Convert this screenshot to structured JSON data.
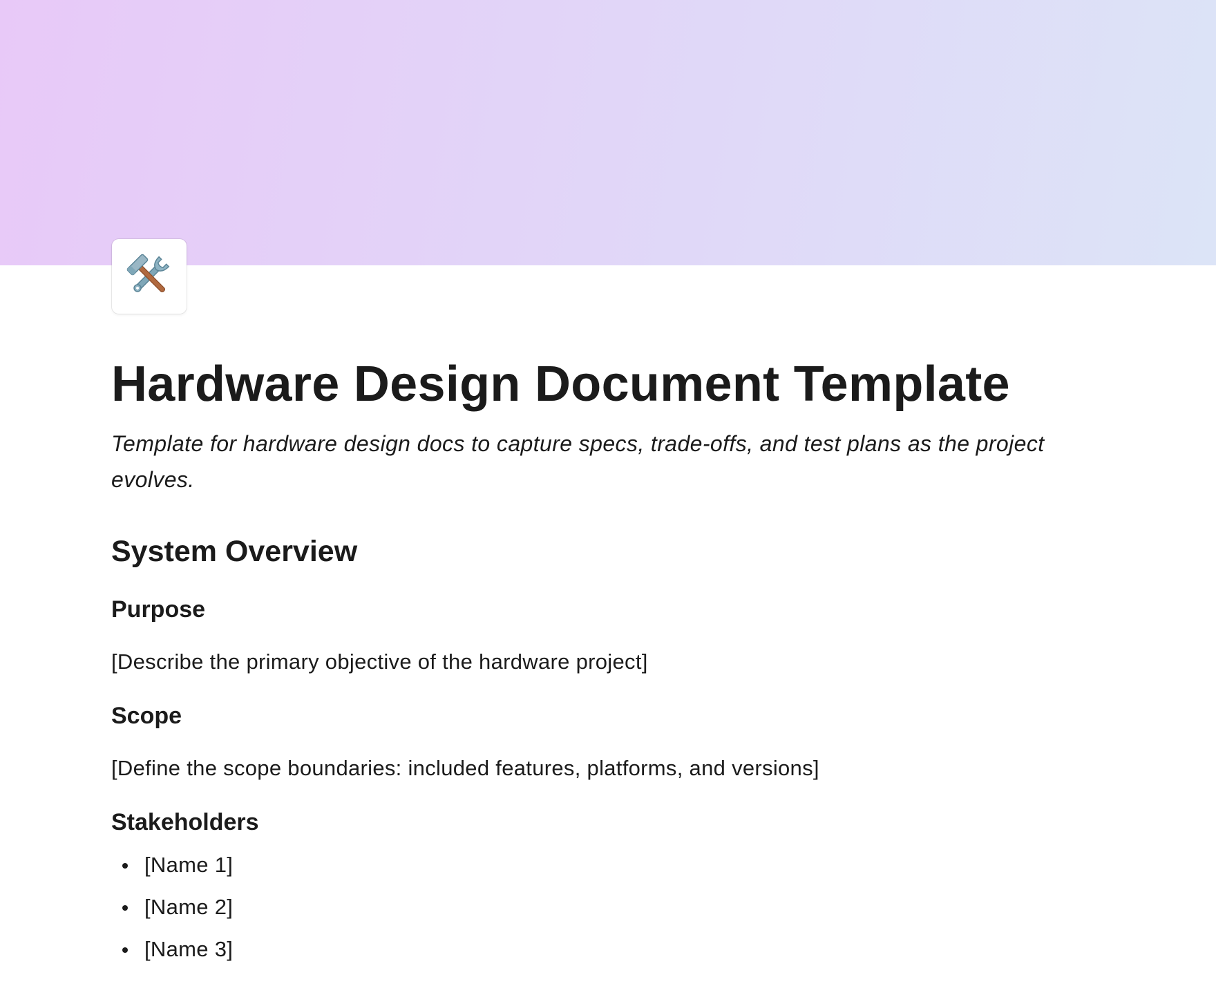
{
  "page": {
    "icon": "hammer-and-wrench-icon",
    "title": "Hardware Design Document Template",
    "subtitle": "Template for hardware design docs to capture specs, trade-offs, and test plans as the project evolves."
  },
  "sections": {
    "system_overview": {
      "heading": "System Overview",
      "purpose": {
        "heading": "Purpose",
        "text": "[Describe the primary objective of the hardware project]"
      },
      "scope": {
        "heading": "Scope",
        "text": "[Define the scope boundaries: included features, platforms, and versions]"
      },
      "stakeholders": {
        "heading": "Stakeholders",
        "items": [
          "[Name 1]",
          "[Name 2]",
          "[Name 3]"
        ]
      }
    }
  },
  "colors": {
    "cover_start": "#e8c9f8",
    "cover_end": "#dce4f7",
    "text": "#1b1b1b"
  }
}
